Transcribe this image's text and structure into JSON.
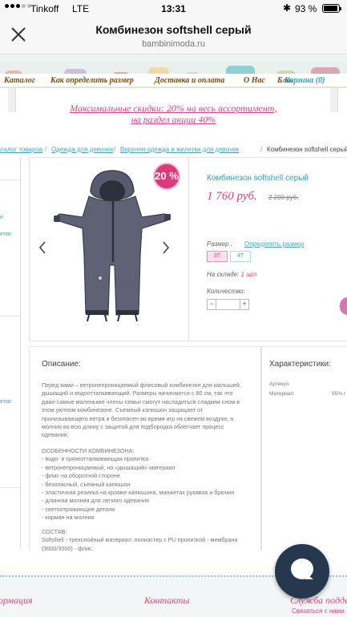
{
  "status_bar": {
    "carrier": "Tinkoff",
    "network": "LTE",
    "time": "13:31",
    "battery": "93 %",
    "battery_level": 0.93
  },
  "browser": {
    "title": "Комбинезон softshell серый",
    "url": "bambinimoda.ru",
    "close_icon": "close-icon"
  },
  "nav": {
    "items": [
      "Каталог",
      "Как определить размер",
      "Доставка и оплата",
      "О Нас"
    ],
    "overlap": "Блог",
    "cart": "Корзина (0)"
  },
  "promo": {
    "line1": "Максимальные скидки: 20% на весь ассортимент,",
    "line2": "на раздел акции 40%"
  },
  "breadcrumbs": {
    "items": [
      "Каталог товаров",
      "Одежда для девочек",
      "Верхняя одежда и жилетки для девочек"
    ],
    "current": "Комбинезон softshell серый",
    "separator": "/"
  },
  "sidebar_partial": {
    "items": [
      "и",
      "етки",
      "етки"
    ]
  },
  "product": {
    "discount_badge": "20 %",
    "name": "Комбинезон softshell серый",
    "price": "1 760 руб.",
    "old_price": "2 200 руб.",
    "size_label": "Размер :",
    "size_link": "Определить размер",
    "sizes": [
      "3T",
      "4T"
    ],
    "stock_label": "На складе:",
    "stock_value": "1 шт",
    "qty_label": "Количество:",
    "qty_minus": "−",
    "qty_plus": "+",
    "qty_value": ""
  },
  "description": {
    "heading": "Описание:",
    "para1": [
      "Перед вами – ветронепроницаемый флисовый комбинезон для малышей,",
      "дышащий и водоотталкивающий. Размеры начинаются с 80 см, так что",
      "даже самые маленькие члены семьи смогут насладиться сладким сном в",
      "этом уютном комбинезоне. Съемный капюшон защищает от",
      "пронизывающего ветра и безопасен во время игр на свежем воздухе, а",
      "молния во всю длину с защитой для подбородка облегчает процесс",
      "одевания."
    ],
    "features_title": "ОСОБЕННОСТИ КОМБИНЕЗОНА:",
    "features": [
      "- водо- и грязеотталкивающая пропитка",
      "- ветронепроницаемый, но «дышащий» материал",
      "- флис на оборотной стороне",
      "- безопасный, съемный капюшон",
      "- эластичная резинка на кромке капюшона, манжетах рукавов и брючин",
      "- длинная молния для легкого одевания",
      "- светоотражающие детали",
      "- карман на молнии"
    ],
    "composition_title": "СОСТАВ:",
    "composition": [
      "Softshell - трехслойный материал: полиэстер с PU пропиткой - мембрана",
      "(3000/3000) - флис."
    ]
  },
  "characteristics": {
    "heading": "Характеристики:",
    "rows": [
      {
        "key": "Артикул",
        "value": ""
      },
      {
        "key": "Материал",
        "value": "95% г"
      }
    ]
  },
  "footer": {
    "items": [
      "ормация",
      "Контакты",
      "Служба подде"
    ],
    "subtext": "Связаться с нами"
  },
  "colors": {
    "accent_pink": "#d9487f",
    "accent_teal": "#3aa0b7",
    "chat_button": "#26384d"
  }
}
